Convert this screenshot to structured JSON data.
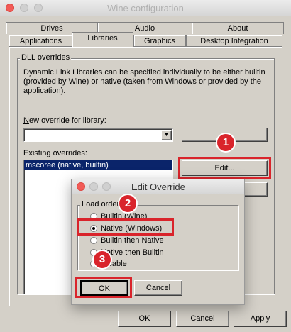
{
  "window": {
    "title": "Wine configuration"
  },
  "tabs_back": [
    "Drives",
    "Audio",
    "About"
  ],
  "tabs_front": [
    "Applications",
    "Libraries",
    "Graphics",
    "Desktop Integration"
  ],
  "dll_overrides": {
    "group_label": "DLL overrides",
    "description": "Dynamic Link Libraries can be specified individually to be either builtin (provided by Wine) or native (taken from Windows or provided by the application).",
    "new_override_label": "New override for library:",
    "new_override_value": "",
    "add_button": "",
    "existing_label": "Existing overrides:",
    "existing_items": [
      "mscoree (native, builtin)"
    ],
    "edit_button": "Edit...",
    "remove_button": ""
  },
  "bottom_buttons": {
    "ok": "OK",
    "cancel": "Cancel",
    "apply": "Apply"
  },
  "dialog": {
    "title": "Edit Override",
    "group_label": "Load order",
    "options": [
      "Builtin (Wine)",
      "Native (Windows)",
      "Builtin then Native",
      "Native then Builtin",
      "Disable"
    ],
    "selected_index": 1,
    "ok": "OK",
    "cancel": "Cancel"
  },
  "annotations": [
    "1",
    "2",
    "3"
  ],
  "colors": {
    "highlight": "#d9242b",
    "selection": "#0a246a"
  }
}
